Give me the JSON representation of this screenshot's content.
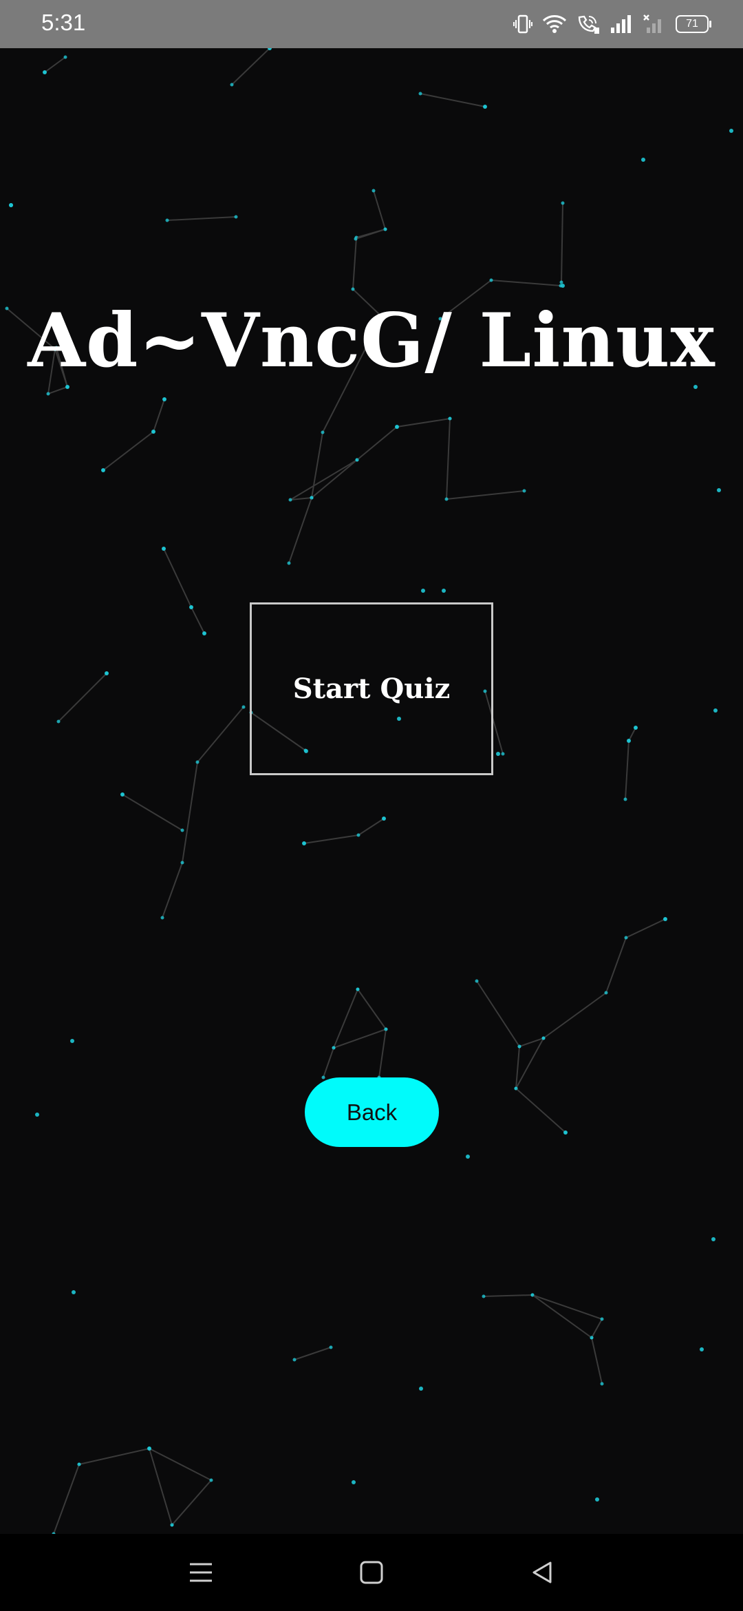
{
  "status_bar": {
    "time": "5:31",
    "battery_level": "71",
    "icons": [
      "vibrate-icon",
      "wifi-icon",
      "wifi-calling-icon",
      "signal-icon",
      "no-signal-icon",
      "battery-icon"
    ]
  },
  "main": {
    "title": "Ad~VncG/ Linux",
    "start_quiz_label": "Start Quiz",
    "back_label": "Back"
  },
  "background": {
    "style": "particle-network",
    "node_color": "#1ec8d6",
    "line_color": "#3a3a3a"
  },
  "colors": {
    "background": "#0a0a0b",
    "accent": "#00fbfb",
    "status_bar": "#7b7b7b"
  },
  "nav_bar": {
    "icons": [
      "menu-icon",
      "home-icon",
      "back-icon"
    ]
  }
}
